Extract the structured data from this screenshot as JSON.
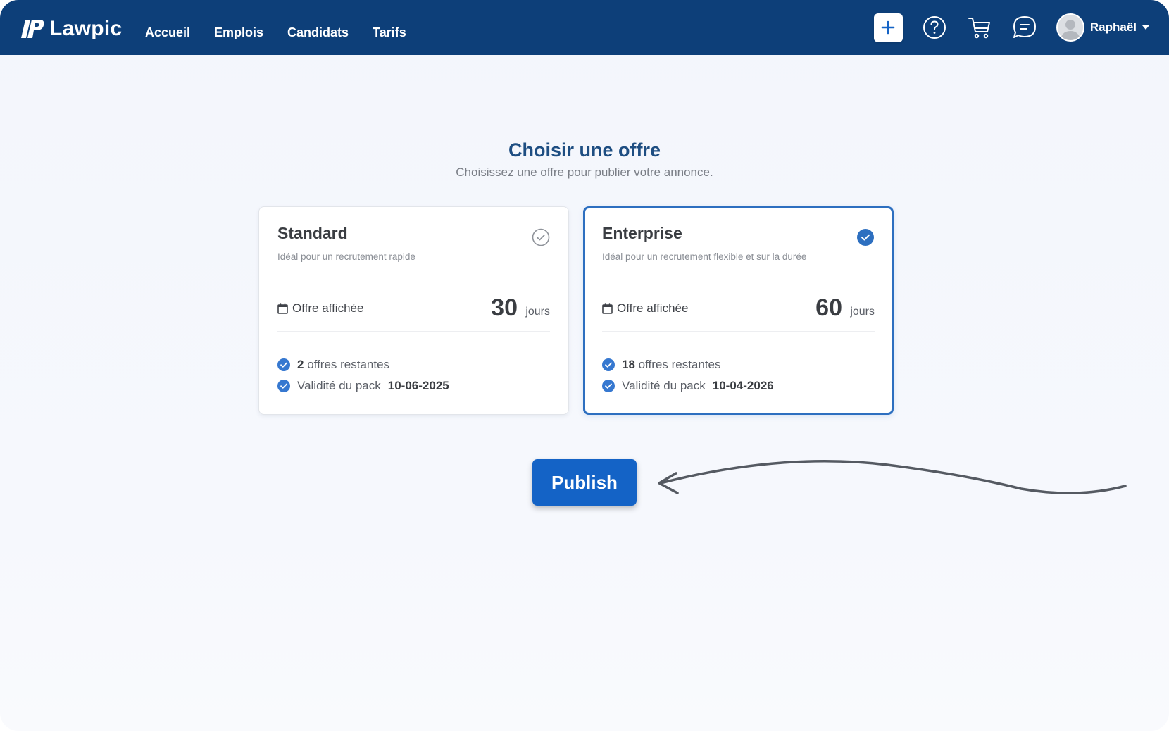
{
  "navbar": {
    "brand": "Lawpic",
    "links": [
      {
        "label": "Accueil"
      },
      {
        "label": "Emplois"
      },
      {
        "label": "Candidats"
      },
      {
        "label": "Tarifs"
      }
    ],
    "user_name": "Raphaël",
    "icons": [
      "plus-icon",
      "help-icon",
      "cart-icon",
      "chat-icon",
      "avatar-icon",
      "caret-down-icon"
    ]
  },
  "page": {
    "title": "Choisir une offre",
    "subtitle": "Choisissez une offre pour publier votre annonce."
  },
  "offers": [
    {
      "name": "Standard",
      "description": "Idéal pour un recrutement rapide",
      "display_label": "Offre affichée",
      "days": "30",
      "days_unit": "jours",
      "remaining_count": "2",
      "remaining_label": "offres restantes",
      "validity_label": "Validité du pack",
      "validity_date": "10-06-2025",
      "selected": false
    },
    {
      "name": "Enterprise",
      "description": "Idéal pour un recrutement flexible et sur la durée",
      "display_label": "Offre affichée",
      "days": "60",
      "days_unit": "jours",
      "remaining_count": "18",
      "remaining_label": "offres restantes",
      "validity_label": "Validité du pack",
      "validity_date": "10-04-2026",
      "selected": true
    }
  ],
  "publish_label": "Publish",
  "colors": {
    "navbar": "#0d3f79",
    "accent": "#1463c6",
    "selected_border": "#2d6fc0",
    "heading": "#1e4e82"
  }
}
